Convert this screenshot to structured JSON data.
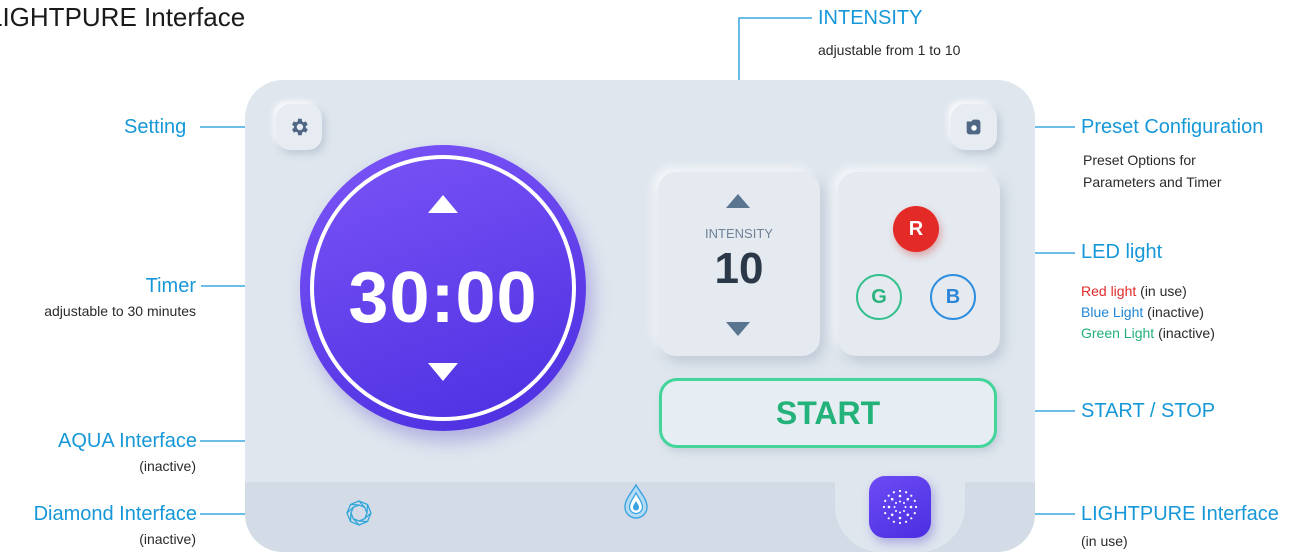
{
  "page": {
    "title": "LIGHTPURE Interface"
  },
  "callouts": {
    "setting": {
      "label": "Setting"
    },
    "timer": {
      "label": "Timer",
      "sub": "adjustable to 30 minutes"
    },
    "aqua": {
      "label": "AQUA Interface",
      "sub": "(inactive)"
    },
    "diamond": {
      "label": "Diamond Interface",
      "sub": "(inactive)"
    },
    "intensity": {
      "label": "INTENSITY",
      "sub": "adjustable from 1 to 10"
    },
    "preset": {
      "label": "Preset Configuration",
      "sub_line1": "Preset Options for",
      "sub_line2": "Parameters and Timer"
    },
    "led": {
      "label": "LED light",
      "red": {
        "name": "Red light",
        "status": "(in use)",
        "color": "#e32b2b"
      },
      "blue": {
        "name": "Blue Light",
        "status": "(inactive)",
        "color": "#1f86d6"
      },
      "green": {
        "name": "Green Light",
        "status": "(inactive)",
        "color": "#22b07a"
      }
    },
    "start_stop": {
      "label": "START / STOP"
    },
    "lightpure": {
      "label": "LIGHTPURE Interface",
      "sub": "(in use)"
    }
  },
  "device": {
    "timer": {
      "value": "30:00"
    },
    "intensity": {
      "label": "INTENSITY",
      "value": "10"
    },
    "led_buttons": {
      "red": "R",
      "green": "G",
      "blue": "B"
    },
    "start_button": {
      "label": "START"
    },
    "icons": {
      "setting": "gear-icon",
      "preset": "camera-icon",
      "timer_up": "arrow-up-icon",
      "timer_down": "arrow-down-icon",
      "diamond": "diamond-icon",
      "aqua": "water-drop-icon",
      "lightpure": "light-burst-icon"
    }
  },
  "colors": {
    "accent_blue": "#1698d8",
    "timer_purple": "#5a3aea",
    "start_green": "#23b27a",
    "device_bg": "#dfe6ee"
  }
}
